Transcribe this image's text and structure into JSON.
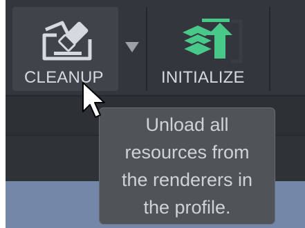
{
  "toolbar": {
    "cleanup": {
      "label": "CLEANUP",
      "icon": "eraser-icon"
    },
    "dropdown": {
      "icon": "caret-down-icon"
    },
    "initialize": {
      "label": "INITIALIZE",
      "icon": "stack-upload-icon"
    }
  },
  "tooltip": {
    "lines": [
      "Unload all",
      "resources from",
      "the renderers in",
      "the profile."
    ]
  },
  "cursor": {
    "icon": "mouse-pointer-icon"
  },
  "colors": {
    "toolbar_bg": "#33373d",
    "button_hover_bg": "#3f434a",
    "accent_green": "#48c98a",
    "tooltip_bg": "#4f5459",
    "text_light": "#d6d9dd",
    "lower_blue": "#7387a9"
  }
}
